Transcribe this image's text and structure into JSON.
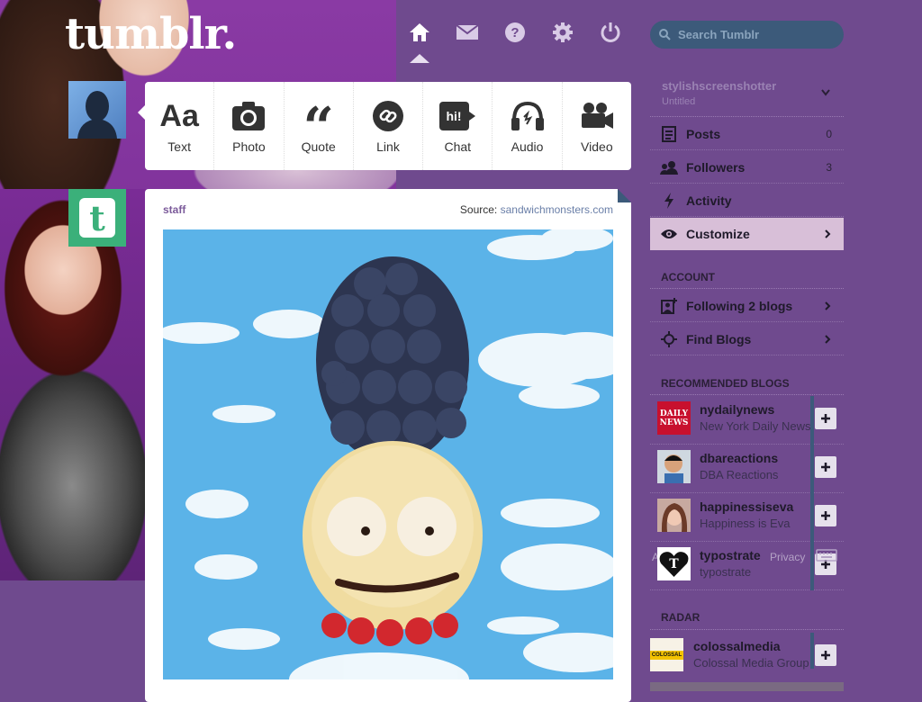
{
  "brand": {
    "logo": "tumblr."
  },
  "nav": {
    "items": [
      {
        "name": "home",
        "icon": "home-icon"
      },
      {
        "name": "messages",
        "icon": "envelope-icon"
      },
      {
        "name": "help",
        "icon": "help-icon"
      },
      {
        "name": "settings",
        "icon": "gear-icon"
      },
      {
        "name": "logout",
        "icon": "power-icon"
      }
    ],
    "active": "home"
  },
  "search": {
    "placeholder": "Search Tumblr"
  },
  "post_types": [
    {
      "label": "Text",
      "icon": "text-icon"
    },
    {
      "label": "Photo",
      "icon": "camera-icon"
    },
    {
      "label": "Quote",
      "icon": "quote-icon"
    },
    {
      "label": "Link",
      "icon": "link-icon"
    },
    {
      "label": "Chat",
      "icon": "chat-icon",
      "icon_text": "hi!"
    },
    {
      "label": "Audio",
      "icon": "headphones-icon"
    },
    {
      "label": "Video",
      "icon": "video-camera-icon"
    }
  ],
  "post": {
    "author": "staff",
    "source_prefix": "Source:",
    "source_link": "sandwichmonsters.com",
    "image": "photo-marge-simpson-food-art"
  },
  "sidebar": {
    "blog_name": "stylishscreenshotter",
    "blog_subtitle": "Untitled",
    "menu": [
      {
        "label": "Posts",
        "count": "0",
        "icon": "posts-icon"
      },
      {
        "label": "Followers",
        "count": "3",
        "icon": "followers-icon"
      },
      {
        "label": "Activity",
        "icon": "lightning-icon"
      },
      {
        "label": "Customize",
        "icon": "eye-icon",
        "active": true
      }
    ],
    "account_heading": "ACCOUNT",
    "account": [
      {
        "label": "Following 2 blogs",
        "icon": "following-icon"
      },
      {
        "label": "Find Blogs",
        "icon": "find-blogs-icon"
      }
    ],
    "recommended_heading": "RECOMMENDED BLOGS",
    "recommended": [
      {
        "name": "nydailynews",
        "title": "New York Daily News",
        "thumb_text": "DAILY NEWS"
      },
      {
        "name": "dbareactions",
        "title": "DBA Reactions"
      },
      {
        "name": "happinessiseva",
        "title": "Happiness is Eva"
      },
      {
        "name": "typostrate",
        "title": "typostrate",
        "thumb_text": "T"
      }
    ],
    "footer_ghost_left": "Ab",
    "footer_ghost_right": "Privacy",
    "radar_heading": "RADAR",
    "radar": [
      {
        "name": "colossalmedia",
        "title": "Colossal Media Group",
        "thumb_text": "COLOSSAL"
      }
    ]
  },
  "colors": {
    "background": "#6f4a8e",
    "search_bg": "#3c5a7a",
    "active_item": "#d8bfd8",
    "staff_avatar": "#3bb07a"
  }
}
